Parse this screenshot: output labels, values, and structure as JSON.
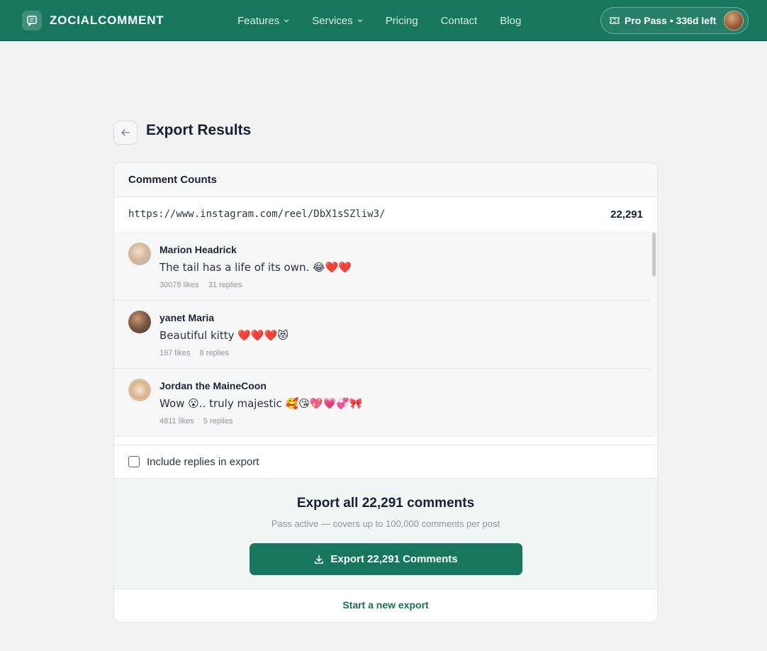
{
  "colors": {
    "brand": "#16775e",
    "page_background": "#f2f2f2",
    "link": "#1a6d55"
  },
  "header": {
    "brand_name": "ZOCIALCOMMENT",
    "brand_icon": "chat-bubble-icon",
    "nav": [
      {
        "label": "Features",
        "has_dropdown": true
      },
      {
        "label": "Services",
        "has_dropdown": true
      },
      {
        "label": "Pricing",
        "has_dropdown": false
      },
      {
        "label": "Contact",
        "has_dropdown": false
      },
      {
        "label": "Blog",
        "has_dropdown": false
      }
    ],
    "pass": {
      "icon": "ticket-icon",
      "label": "Pro Pass • 336d left"
    }
  },
  "page": {
    "back_icon": "arrow-left-icon",
    "title": "Export Results"
  },
  "card": {
    "title": "Comment Counts",
    "url": "https://www.instagram.com/reel/DbX1sSZliw3/",
    "count": "22,291",
    "comments": [
      {
        "author": "Marion Headrick",
        "text": "The tail has a life of its own. 😂❤️❤️",
        "likes": "30078 likes",
        "replies": "31 replies"
      },
      {
        "author": "yanet Maria",
        "text": "Beautiful kitty ❤️❤️❤️😻",
        "likes": "197 likes",
        "replies": "8 replies"
      },
      {
        "author": "Jordan the MaineCoon",
        "text": "Wow 😮.. truly majestic 🥰😘💖💗💞🎀",
        "likes": "4811 likes",
        "replies": "5 replies"
      }
    ],
    "include_replies": {
      "label": "Include replies in export",
      "checked": false
    },
    "export": {
      "title": "Export all 22,291 comments",
      "subtitle": "Pass active — covers up to 100,000 comments per post",
      "button_label": "Export 22,291 Comments",
      "button_icon": "download-icon"
    },
    "new_export_label": "Start a new export"
  }
}
